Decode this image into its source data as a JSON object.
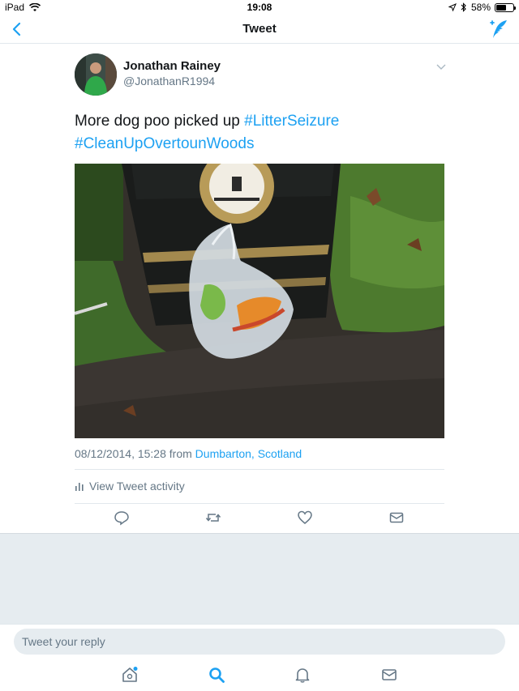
{
  "status_bar": {
    "device": "iPad",
    "time": "19:08",
    "battery": "58%",
    "battery_level": 0.58
  },
  "nav": {
    "title": "Tweet"
  },
  "tweet": {
    "author_name": "Jonathan Rainey",
    "author_handle": "@JonathanR1994",
    "text_plain": "More dog poo picked up ",
    "hashtag_1": "#LitterSeizure",
    "hashtag_2": "#CleanUpOvertounWoods",
    "timestamp": "08/12/2014, 15:28 from ",
    "location": "Dumbarton, Scotland",
    "activity_label": "View Tweet activity"
  },
  "reply": {
    "placeholder": "Tweet your reply"
  },
  "icons": {
    "back": "chevron-left-icon",
    "compose": "compose-tweet-icon",
    "reply": "reply-icon",
    "retweet": "retweet-icon",
    "like": "heart-icon",
    "dm": "envelope-icon",
    "home": "home-icon",
    "search": "search-icon",
    "notifications": "bell-icon",
    "messages": "envelope-icon"
  },
  "colors": {
    "accent": "#1da1f2",
    "text": "#14171a",
    "secondary": "#657786",
    "background_grey": "#e6ecf0"
  }
}
